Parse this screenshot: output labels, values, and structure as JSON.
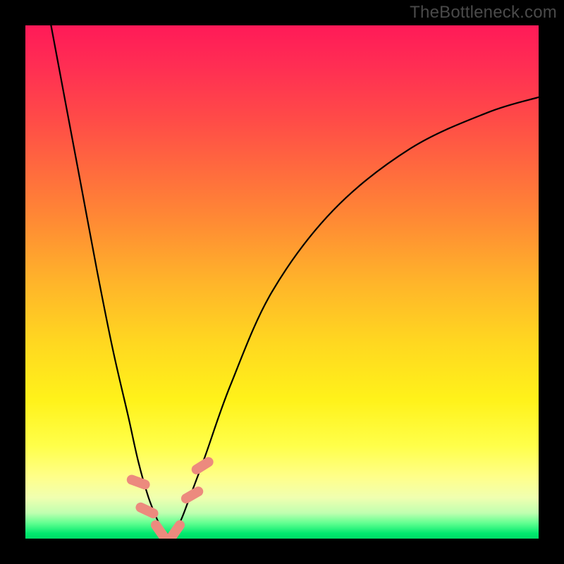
{
  "watermark": "TheBottleneck.com",
  "chart_data": {
    "type": "line",
    "title": "",
    "xlabel": "",
    "ylabel": "",
    "xlim": [
      0,
      100
    ],
    "ylim": [
      0,
      100
    ],
    "grid": false,
    "legend": false,
    "color_scale_comment": "background gradient from red (100) through orange/yellow to green (0)",
    "series": [
      {
        "name": "bottleneck-curve",
        "color": "#000000",
        "x": [
          5,
          8,
          11,
          14,
          17,
          20,
          22,
          24,
          26,
          27,
          28,
          30,
          32,
          35,
          40,
          48,
          60,
          75,
          90,
          100
        ],
        "y": [
          100,
          84,
          68,
          52,
          37,
          24,
          15,
          8,
          3,
          1,
          1,
          3,
          8,
          16,
          30,
          48,
          64,
          76,
          83,
          86
        ]
      }
    ],
    "markers": [
      {
        "name": "pink-marker",
        "x": 22.0,
        "y": 11.0,
        "angle": -70
      },
      {
        "name": "pink-marker",
        "x": 23.7,
        "y": 5.5,
        "angle": -65
      },
      {
        "name": "pink-marker",
        "x": 26.2,
        "y": 1.5,
        "angle": -35
      },
      {
        "name": "pink-marker",
        "x": 29.3,
        "y": 1.5,
        "angle": 35
      },
      {
        "name": "pink-marker",
        "x": 32.5,
        "y": 8.5,
        "angle": 60
      },
      {
        "name": "pink-marker",
        "x": 34.5,
        "y": 14.2,
        "angle": 58
      }
    ]
  }
}
